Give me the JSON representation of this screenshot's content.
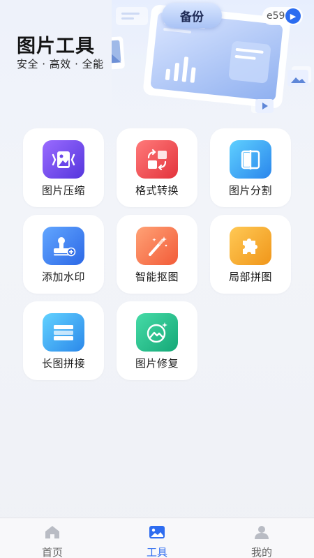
{
  "header": {
    "title": "图片工具",
    "subtitle": "安全 · 高效 · 全能",
    "badge": "备份",
    "chip": "e59"
  },
  "tools": [
    {
      "label": "图片压缩",
      "icon": "image-compress-icon",
      "colors": [
        "#8a5cf6",
        "#5a3ce0"
      ]
    },
    {
      "label": "格式转换",
      "icon": "format-convert-icon",
      "colors": [
        "#ff6f6f",
        "#e8393f"
      ]
    },
    {
      "label": "图片分割",
      "icon": "image-split-icon",
      "colors": [
        "#58c6ff",
        "#2e8fef"
      ]
    },
    {
      "label": "添加水印",
      "icon": "watermark-stamp-icon",
      "colors": [
        "#5aa0ff",
        "#2f6eea"
      ]
    },
    {
      "label": "智能抠图",
      "icon": "magic-wand-icon",
      "colors": [
        "#ff9b6a",
        "#f4643c"
      ]
    },
    {
      "label": "局部拼图",
      "icon": "puzzle-piece-icon",
      "colors": [
        "#ffc24a",
        "#f39a1d"
      ]
    },
    {
      "label": "长图拼接",
      "icon": "long-image-stitch-icon",
      "colors": [
        "#58c6ff",
        "#2e8fef"
      ]
    },
    {
      "label": "图片修复",
      "icon": "image-repair-icon",
      "colors": [
        "#3fd6a0",
        "#17b07c"
      ]
    }
  ],
  "nav": {
    "home": "首页",
    "tools": "工具",
    "mine": "我的",
    "active_color": "#2e6cf0"
  }
}
